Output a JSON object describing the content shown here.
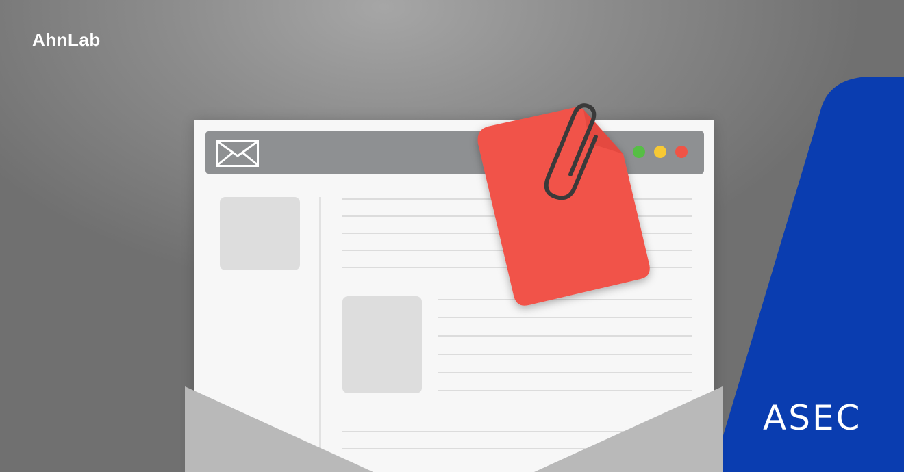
{
  "brand": {
    "name": "AhnLab"
  },
  "badge": {
    "name": "ASEC"
  },
  "colors": {
    "background": "#8c8c8c",
    "blue": "#0a3db0",
    "attachment": "#f15248",
    "window_bar": "#8e9092",
    "dot_green": "#56be45",
    "dot_yellow": "#f7c934",
    "dot_red": "#f05446"
  },
  "icons": [
    "mail-icon",
    "paperclip-icon",
    "attachment-file-icon"
  ]
}
